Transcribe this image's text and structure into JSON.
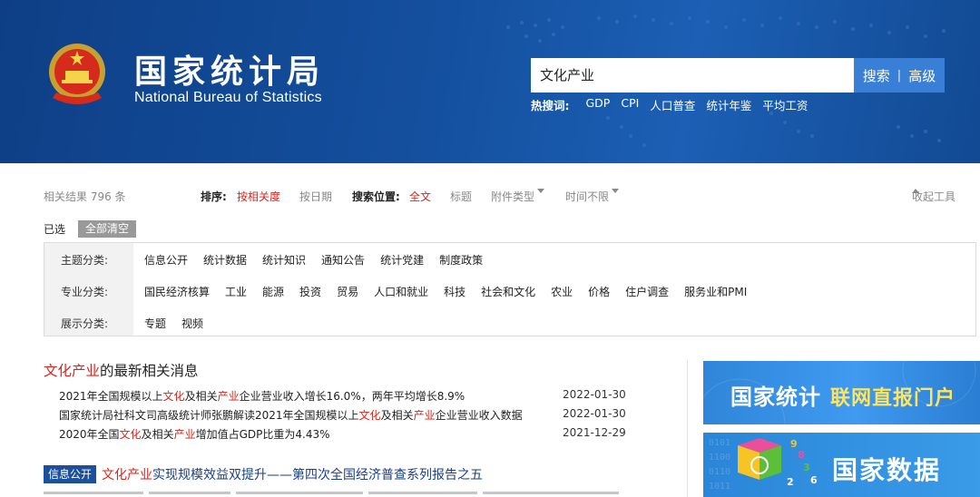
{
  "header": {
    "title": "国家统计局",
    "subtitle": "National Bureau of Statistics",
    "search_value": "文化产业",
    "search_button": "搜索",
    "separator": "|",
    "advanced_button": "高级",
    "hot_label": "热搜词:",
    "hot_words": [
      "GDP",
      "CPI",
      "人口普查",
      "统计年鉴",
      "平均工资"
    ]
  },
  "toolbar": {
    "result_count": "相关结果 796 条",
    "sort_label": "排序:",
    "sort_relevance": "按相关度",
    "sort_date": "按日期",
    "position_label": "搜索位置:",
    "position_full": "全文",
    "position_title": "标题",
    "attachment_type": "附件类型",
    "time_range": "时间不限",
    "collapse_tools": "收起工具"
  },
  "selected": {
    "label": "已选",
    "clear_all": "全部清空"
  },
  "filters": [
    {
      "label": "主题分类:",
      "items": [
        "信息公开",
        "统计数据",
        "统计知识",
        "通知公告",
        "统计党建",
        "制度政策"
      ]
    },
    {
      "label": "专业分类:",
      "items": [
        "国民经济核算",
        "工业",
        "能源",
        "投资",
        "贸易",
        "人口和就业",
        "科技",
        "社会和文化",
        "农业",
        "价格",
        "住户调查",
        "服务业和PMI"
      ]
    },
    {
      "label": "展示分类:",
      "items": [
        "专题",
        "视频"
      ]
    }
  ],
  "latest": {
    "keyword": "文化产业",
    "suffix": "的最新相关消息",
    "items": [
      {
        "parts": [
          [
            "2021年全国规模以上",
            false
          ],
          [
            "文化",
            true
          ],
          [
            "及相关",
            false
          ],
          [
            "产业",
            true
          ],
          [
            "企业营业收入增长16.0%，两年平均增长8.9%",
            false
          ]
        ],
        "date": "2022-01-30"
      },
      {
        "parts": [
          [
            "国家统计局社科文司高级统计师张鹏解读2021年全国规模以上",
            false
          ],
          [
            "文化",
            true
          ],
          [
            "及相关",
            false
          ],
          [
            "产业",
            true
          ],
          [
            "企业营业收入数据",
            false
          ]
        ],
        "date": "2022-01-30"
      },
      {
        "parts": [
          [
            "2020年全国",
            false
          ],
          [
            "文化",
            true
          ],
          [
            "及相关",
            false
          ],
          [
            "产业",
            true
          ],
          [
            "增加值占GDP比重为4.43%",
            false
          ]
        ],
        "date": "2021-12-29"
      }
    ]
  },
  "result": {
    "tag": "信息公开",
    "title_keyword": "文化产业",
    "title_rest": "实现规模效益双提升——第四次全国经济普查系列报告之五"
  },
  "banners": {
    "banner1_main": "国家统计",
    "banner1_highlight": "联网直报门户",
    "banner2_main": "国家数据"
  },
  "colors": {
    "header_blue": "#14509f",
    "keyword_red": "#d9251d",
    "tag_blue": "#1c4f9c",
    "banner_blue": "#3a9be8",
    "banner_yellow": "#ffe45c"
  }
}
